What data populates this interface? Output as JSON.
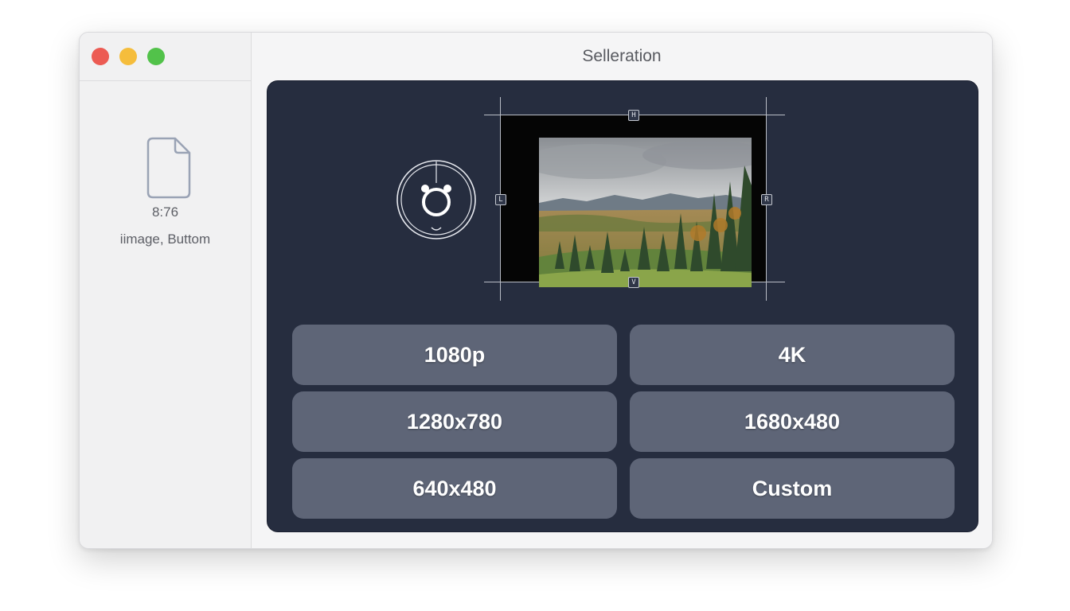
{
  "window": {
    "title": "Selleration",
    "controls": [
      "close",
      "minimize",
      "maximize"
    ]
  },
  "sidebar": {
    "file": {
      "icon": "document-icon",
      "size": "8:76",
      "type": "iimage, Buttom"
    }
  },
  "editor": {
    "dial_icon": "timer-dial-icon",
    "handles": {
      "top": "H",
      "bottom": "V",
      "left": "L",
      "right": "R"
    },
    "photo": "landscape-photo"
  },
  "presets": [
    "1080p",
    "4K",
    "1280x780",
    "1680x480",
    "640x480",
    "Custom"
  ],
  "colors": {
    "panel": "#262d3f",
    "preset_button": "#5e6577",
    "close": "#ec5b53",
    "minimize": "#f5bd3c",
    "maximize": "#52c24a"
  }
}
